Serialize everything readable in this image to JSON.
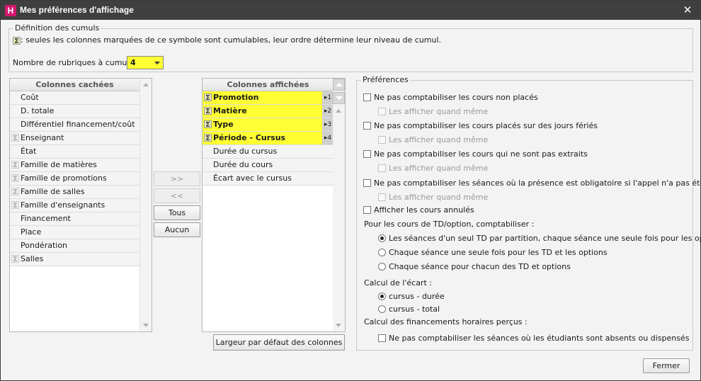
{
  "window": {
    "title": "Mes préférences d'affichage",
    "logo_letter": "H"
  },
  "cumuls": {
    "legend": "Définition des cumuls",
    "info": ": seules les colonnes marquées de ce symbole sont cumulables, leur ordre détermine leur niveau de cumul.",
    "count_label": "Nombre de rubriques à cumuler :",
    "count_value": "4"
  },
  "hidden_columns": {
    "header": "Colonnes cachées",
    "items": [
      {
        "label": "Coût",
        "cumulable": false
      },
      {
        "label": "D. totale",
        "cumulable": false
      },
      {
        "label": "Différentiel financement/coût",
        "cumulable": false
      },
      {
        "label": "Enseignant",
        "cumulable": true
      },
      {
        "label": "État",
        "cumulable": false
      },
      {
        "label": "Famille de matières",
        "cumulable": true
      },
      {
        "label": "Famille de promotions",
        "cumulable": true
      },
      {
        "label": "Famille de salles",
        "cumulable": true
      },
      {
        "label": "Famille d'enseignants",
        "cumulable": true
      },
      {
        "label": "Financement",
        "cumulable": false
      },
      {
        "label": "Place",
        "cumulable": false
      },
      {
        "label": "Pondération",
        "cumulable": false
      },
      {
        "label": "Salles",
        "cumulable": true
      }
    ]
  },
  "transfer_buttons": {
    "add": ">>",
    "remove": "<<",
    "all": "Tous",
    "none": "Aucun"
  },
  "shown_columns": {
    "header": "Colonnes affichées",
    "items": [
      {
        "label": "Promotion",
        "cumul": true,
        "order": "▸1"
      },
      {
        "label": "Matière",
        "cumul": true,
        "order": "▸2"
      },
      {
        "label": "Type",
        "cumul": true,
        "order": "▸3"
      },
      {
        "label": "Période - Cursus",
        "cumul": true,
        "order": "▸4"
      },
      {
        "label": "Durée du cursus",
        "cumul": false,
        "order": ""
      },
      {
        "label": "Durée du cours",
        "cumul": false,
        "order": ""
      },
      {
        "label": "Écart avec le cursus",
        "cumul": false,
        "order": ""
      }
    ],
    "default_width_button": "Largeur par défaut des colonnes"
  },
  "preferences": {
    "legend": "Préférences",
    "options": [
      {
        "label": "Ne pas comptabiliser les cours non placés",
        "sub": "Les afficher quand même"
      },
      {
        "label": "Ne pas comptabiliser les cours placés sur des jours fériés",
        "sub": "Les afficher quand même"
      },
      {
        "label": "Ne pas comptabiliser les cours qui ne sont pas extraits",
        "sub": "Les afficher quand même"
      },
      {
        "label": "Ne pas comptabiliser les séances où la présence est obligatoire si l'appel n'a pas été fait",
        "sub": "Les afficher quand même"
      }
    ],
    "show_cancelled": "Afficher les cours annulés",
    "td_label": "Pour les cours de TD/option, comptabiliser :",
    "td_options": [
      {
        "label": "Les séances d'un seul TD par partition, chaque séance une seule fois pour les options",
        "selected": true
      },
      {
        "label": "Chaque séance une seule fois pour les TD et les options",
        "selected": false
      },
      {
        "label": "Chaque séance pour chacun des TD et options",
        "selected": false
      }
    ],
    "ecart_label": "Calcul de l'écart :",
    "ecart_options": [
      {
        "label": "cursus - durée",
        "selected": true
      },
      {
        "label": "cursus - total",
        "selected": false
      }
    ],
    "financement_label": "Calcul des financements horaires perçus :",
    "financement_option": "Ne pas comptabiliser les séances où les étudiants sont absents ou dispensés"
  },
  "footer": {
    "close": "Fermer"
  },
  "colors": {
    "highlight": "#ffff33",
    "titlebar": "#3f3f3f",
    "logo": "#d3176d"
  }
}
